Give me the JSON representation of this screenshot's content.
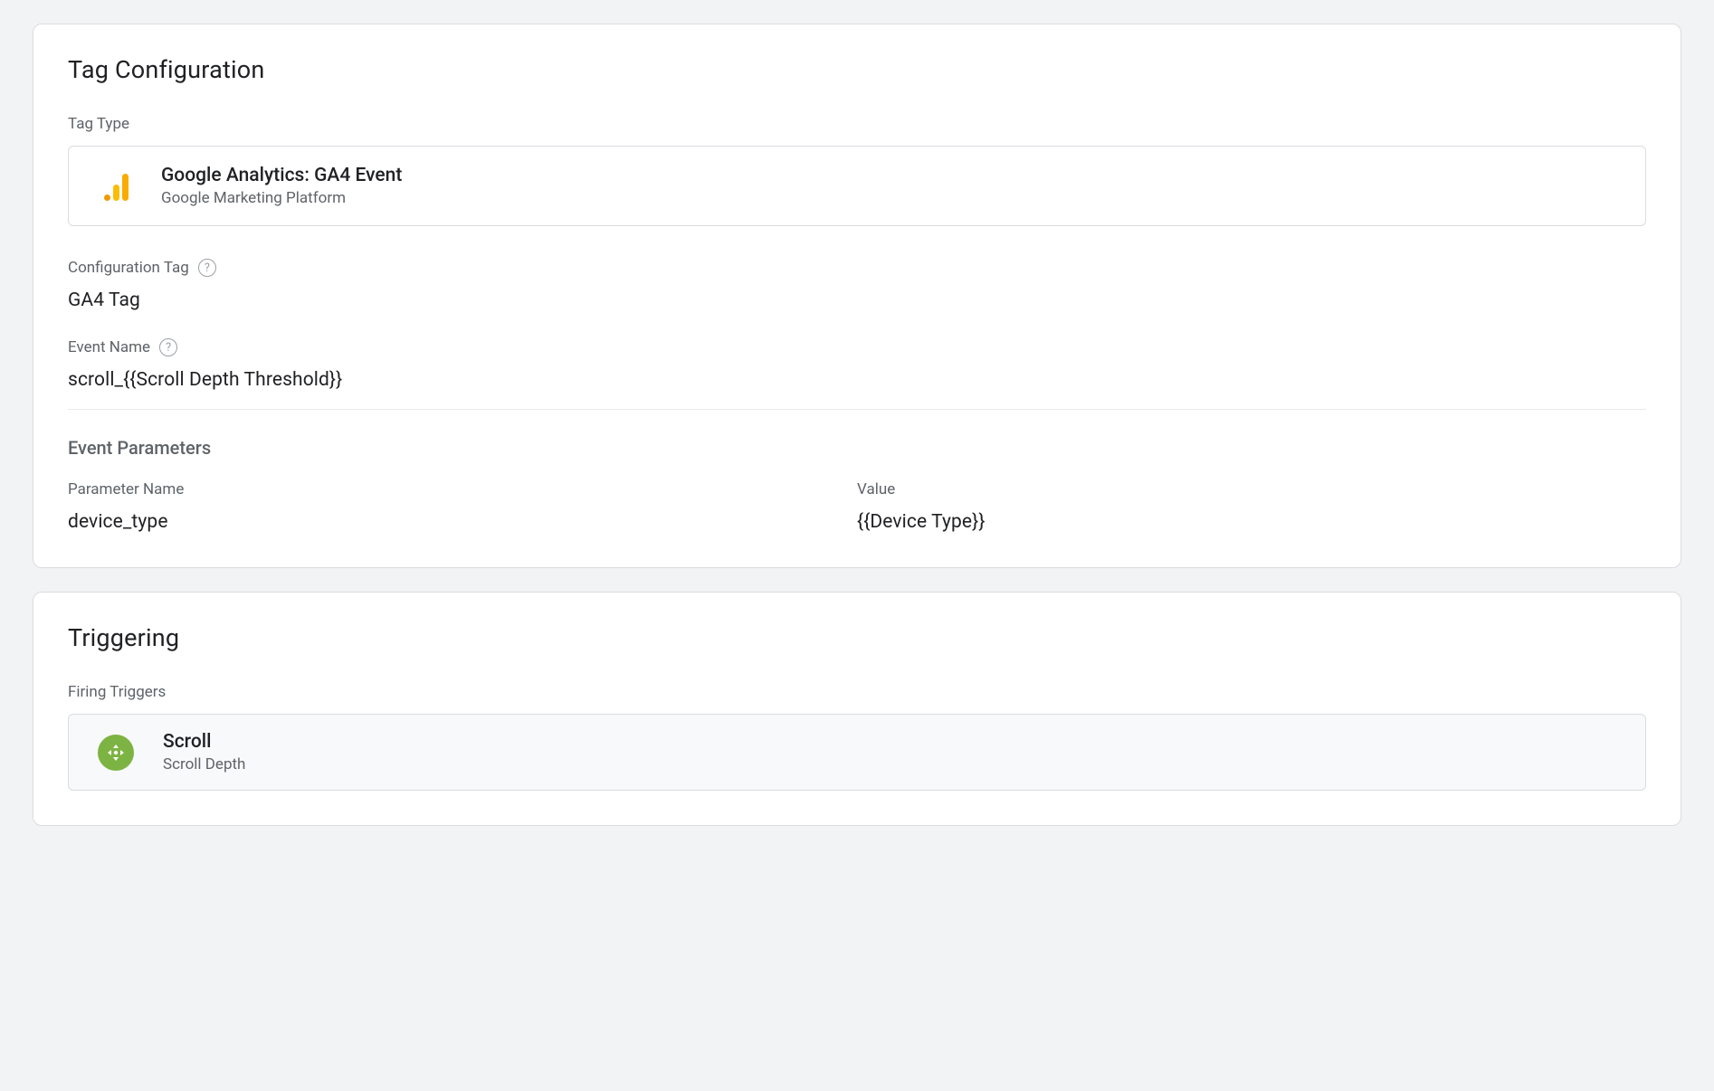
{
  "tag_configuration": {
    "title": "Tag Configuration",
    "tag_type_label": "Tag Type",
    "tag_type": {
      "name": "Google Analytics: GA4 Event",
      "platform": "Google Marketing Platform"
    },
    "configuration_tag_label": "Configuration Tag",
    "configuration_tag_value": "GA4 Tag",
    "event_name_label": "Event Name",
    "event_name_value": "scroll_{{Scroll Depth Threshold}}",
    "event_parameters_heading": "Event Parameters",
    "param_name_header": "Parameter Name",
    "param_value_header": "Value",
    "parameters": {
      "name": "device_type",
      "value": "{{Device Type}}"
    }
  },
  "triggering": {
    "title": "Triggering",
    "firing_triggers_label": "Firing Triggers",
    "trigger": {
      "name": "Scroll",
      "type": "Scroll Depth"
    }
  }
}
